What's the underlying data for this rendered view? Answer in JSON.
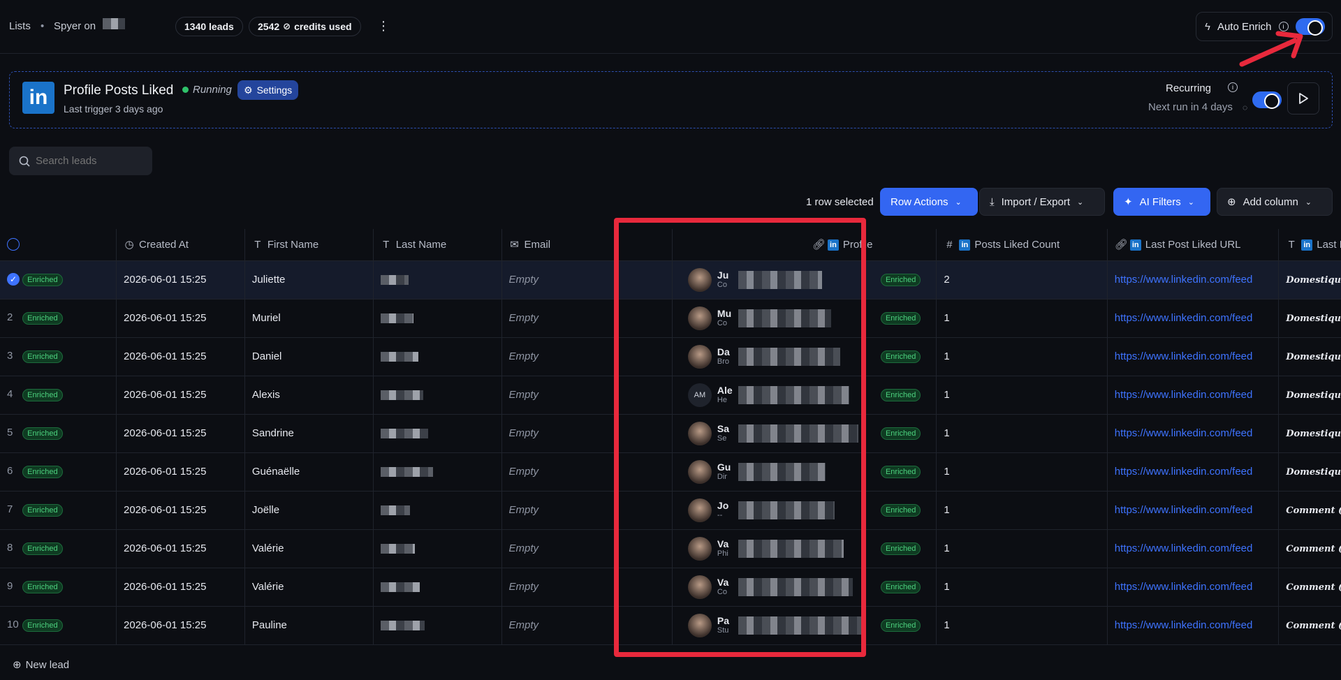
{
  "topbar": {
    "lists": "Lists",
    "workspace": "Spyer on",
    "leads_count": "1340 leads",
    "credits": "2542",
    "credits_suffix": "credits used",
    "auto_enrich": "Auto Enrich"
  },
  "campaign": {
    "title": "Profile Posts Liked",
    "status": "Running",
    "settings": "Settings",
    "last_trigger": "Last trigger 3 days ago",
    "recurring": "Recurring",
    "next_run": "Next run in 4 days"
  },
  "search": {
    "placeholder": "Search leads"
  },
  "toolbar": {
    "selected": "1 row selected",
    "row_actions": "Row Actions",
    "import_export": "Import / Export",
    "ai_filters": "AI Filters",
    "add_column": "Add column"
  },
  "columns": {
    "created_at": "Created At",
    "first_name": "First Name",
    "last_name": "Last Name",
    "email": "Email",
    "profile": "Profile",
    "posts_liked": "Posts Liked Count",
    "last_url": "Last Post Liked URL",
    "last_content": "Last Post Liked Content"
  },
  "rows": [
    {
      "num": "",
      "badge": "Enriched",
      "created": "2026-06-01 15:25",
      "first": "Juliette",
      "email": "Empty",
      "profile_name": "Ju",
      "profile_sub": "Co",
      "profile_badge": "Enriched",
      "count": "2",
      "url": "https://www.linkedin.com/feed",
      "content": "Domestiquer ou subir l'Etat : le..."
    },
    {
      "num": "2",
      "badge": "Enriched",
      "created": "2026-06-01 15:25",
      "first": "Muriel",
      "email": "Empty",
      "profile_name": "Mu",
      "profile_sub": "Co",
      "profile_badge": "Enriched",
      "count": "1",
      "url": "https://www.linkedin.com/feed",
      "content": "Domestiquer ou subir l'Etat : le..."
    },
    {
      "num": "3",
      "badge": "Enriched",
      "created": "2026-06-01 15:25",
      "first": "Daniel",
      "email": "Empty",
      "profile_name": "Da",
      "profile_sub": "Bro",
      "profile_badge": "Enriched",
      "count": "1",
      "url": "https://www.linkedin.com/feed",
      "content": "Domestiquer ou subir l'Etat : le..."
    },
    {
      "num": "4",
      "badge": "Enriched",
      "created": "2026-06-01 15:25",
      "first": "Alexis",
      "email": "Empty",
      "profile_name": "Ale",
      "profile_sub": "He",
      "profile_badge": "Enriched",
      "count": "1",
      "url": "https://www.linkedin.com/feed",
      "content": "Domestiquer ou subir l'Etat : le...",
      "initials": "AM"
    },
    {
      "num": "5",
      "badge": "Enriched",
      "created": "2026-06-01 15:25",
      "first": "Sandrine",
      "email": "Empty",
      "profile_name": "Sa",
      "profile_sub": "Se",
      "profile_badge": "Enriched",
      "count": "1",
      "url": "https://www.linkedin.com/feed",
      "content": "Domestiquer ou subir l'Etat : le..."
    },
    {
      "num": "6",
      "badge": "Enriched",
      "created": "2026-06-01 15:25",
      "first": "Guénaëlle",
      "email": "Empty",
      "profile_name": "Gu",
      "profile_sub": "Dir",
      "profile_badge": "Enriched",
      "count": "1",
      "url": "https://www.linkedin.com/feed",
      "content": "Domestiquer ou subir l'Etat : le..."
    },
    {
      "num": "7",
      "badge": "Enriched",
      "created": "2026-06-01 15:25",
      "first": "Joëlle",
      "email": "Empty",
      "profile_name": "Jo",
      "profile_sub": "--",
      "profile_badge": "Enriched",
      "count": "1",
      "url": "https://www.linkedin.com/feed",
      "content": "Comment (re) penser la..."
    },
    {
      "num": "8",
      "badge": "Enriched",
      "created": "2026-06-01 15:25",
      "first": "Valérie",
      "email": "Empty",
      "profile_name": "Va",
      "profile_sub": "Phi",
      "profile_badge": "Enriched",
      "count": "1",
      "url": "https://www.linkedin.com/feed",
      "content": "Comment (re) penser la..."
    },
    {
      "num": "9",
      "badge": "Enriched",
      "created": "2026-06-01 15:25",
      "first": "Valérie",
      "email": "Empty",
      "profile_name": "Va",
      "profile_sub": "Co",
      "profile_badge": "Enriched",
      "count": "1",
      "url": "https://www.linkedin.com/feed",
      "content": "Comment (re) penser la..."
    },
    {
      "num": "10",
      "badge": "Enriched",
      "created": "2026-06-01 15:25",
      "first": "Pauline",
      "email": "Empty",
      "profile_name": "Pa",
      "profile_sub": "Stu",
      "profile_badge": "Enriched",
      "count": "1",
      "url": "https://www.linkedin.com/feed",
      "content": "Comment (re) penser la..."
    }
  ],
  "footer": {
    "new_lead": "New lead"
  },
  "colors": {
    "accent": "#3366f2",
    "highlight_box": "#e8293c",
    "enriched": "#4cd17e",
    "running": "#2fc16a"
  }
}
